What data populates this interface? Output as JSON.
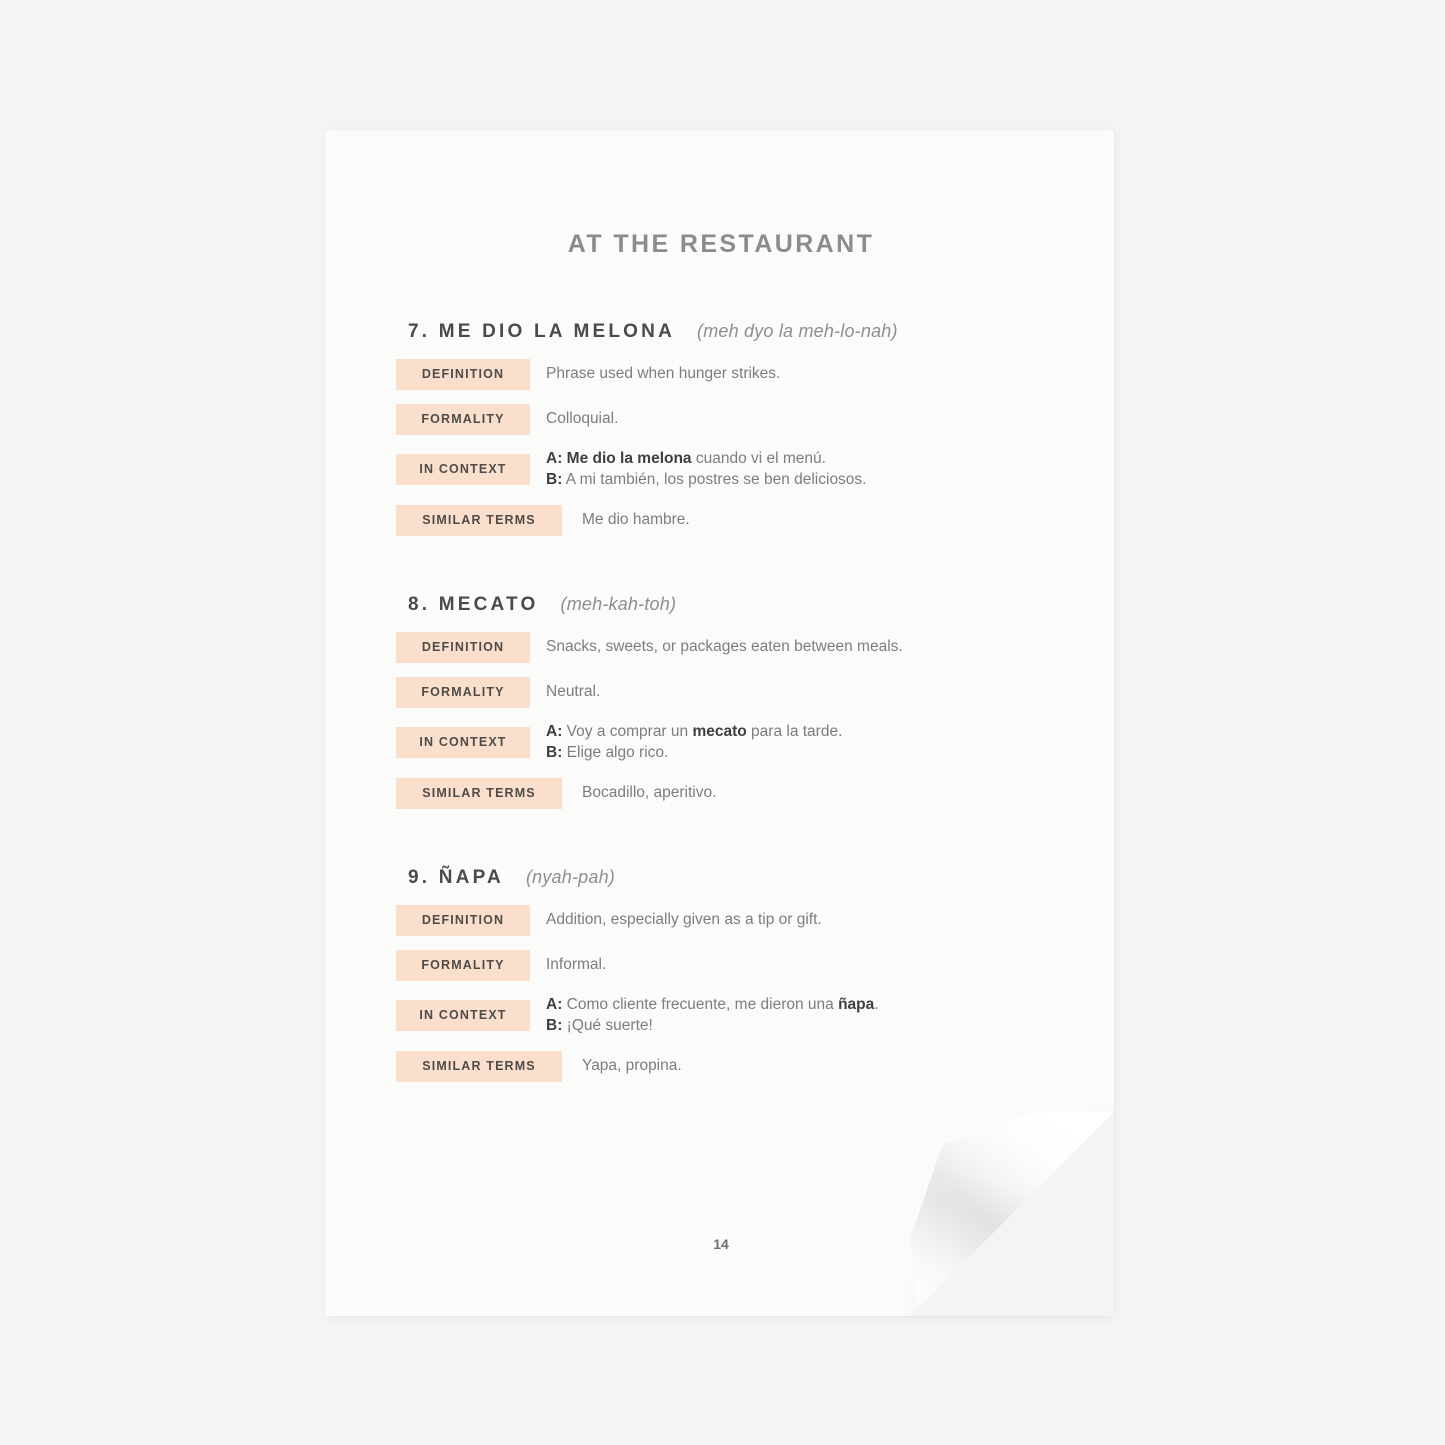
{
  "background_color": "#f4f4f4",
  "page": {
    "background_color": "#fbfbfa",
    "title": "AT THE RESTAURANT",
    "page_number": "14"
  },
  "theme": {
    "tag_background": "#fbdfcd",
    "tag_text": "#4f4b48",
    "title_color": "#8c8c8c",
    "term_color": "#4a4a4a",
    "body_color": "#7d7d7d",
    "emphasis_color": "#3f3f3f"
  },
  "labels": {
    "definition": "DEFINITION",
    "formality": "FORMALITY",
    "in_context": "IN CONTEXT",
    "similar_terms": "SIMILAR TERMS"
  },
  "entries": [
    {
      "term": "7. ME DIO LA MELONA",
      "pronunciation": "(meh dyo la meh-lo-nah)",
      "definition": "Phrase used when hunger strikes.",
      "formality": "Colloquial.",
      "context": [
        {
          "speaker": "A:",
          "before": " ",
          "highlight": "Me dio la melona",
          "after": " cuando vi el menú."
        },
        {
          "speaker": "B:",
          "before": " A mi también, los postres se ben deliciosos.",
          "highlight": "",
          "after": ""
        }
      ],
      "similar_terms": "Me dio hambre."
    },
    {
      "term": "8. MECATO",
      "pronunciation": "(meh-kah-toh)",
      "definition": "Snacks, sweets, or packages eaten between meals.",
      "formality": "Neutral.",
      "context": [
        {
          "speaker": "A:",
          "before": " Voy a comprar un ",
          "highlight": "mecato",
          "after": " para la tarde."
        },
        {
          "speaker": "B:",
          "before": " Elige algo rico.",
          "highlight": "",
          "after": ""
        }
      ],
      "similar_terms": "Bocadillo, aperitivo."
    },
    {
      "term": "9. ÑAPA",
      "pronunciation": "(nyah-pah)",
      "definition": "Addition, especially given as a tip or gift.",
      "formality": "Informal.",
      "context": [
        {
          "speaker": "A:",
          "before": " Como cliente frecuente, me dieron una ",
          "highlight": "ñapa",
          "after": "."
        },
        {
          "speaker": "B:",
          "before": " ¡Qué suerte!",
          "highlight": "",
          "after": ""
        }
      ],
      "similar_terms": "Yapa, propina."
    }
  ]
}
